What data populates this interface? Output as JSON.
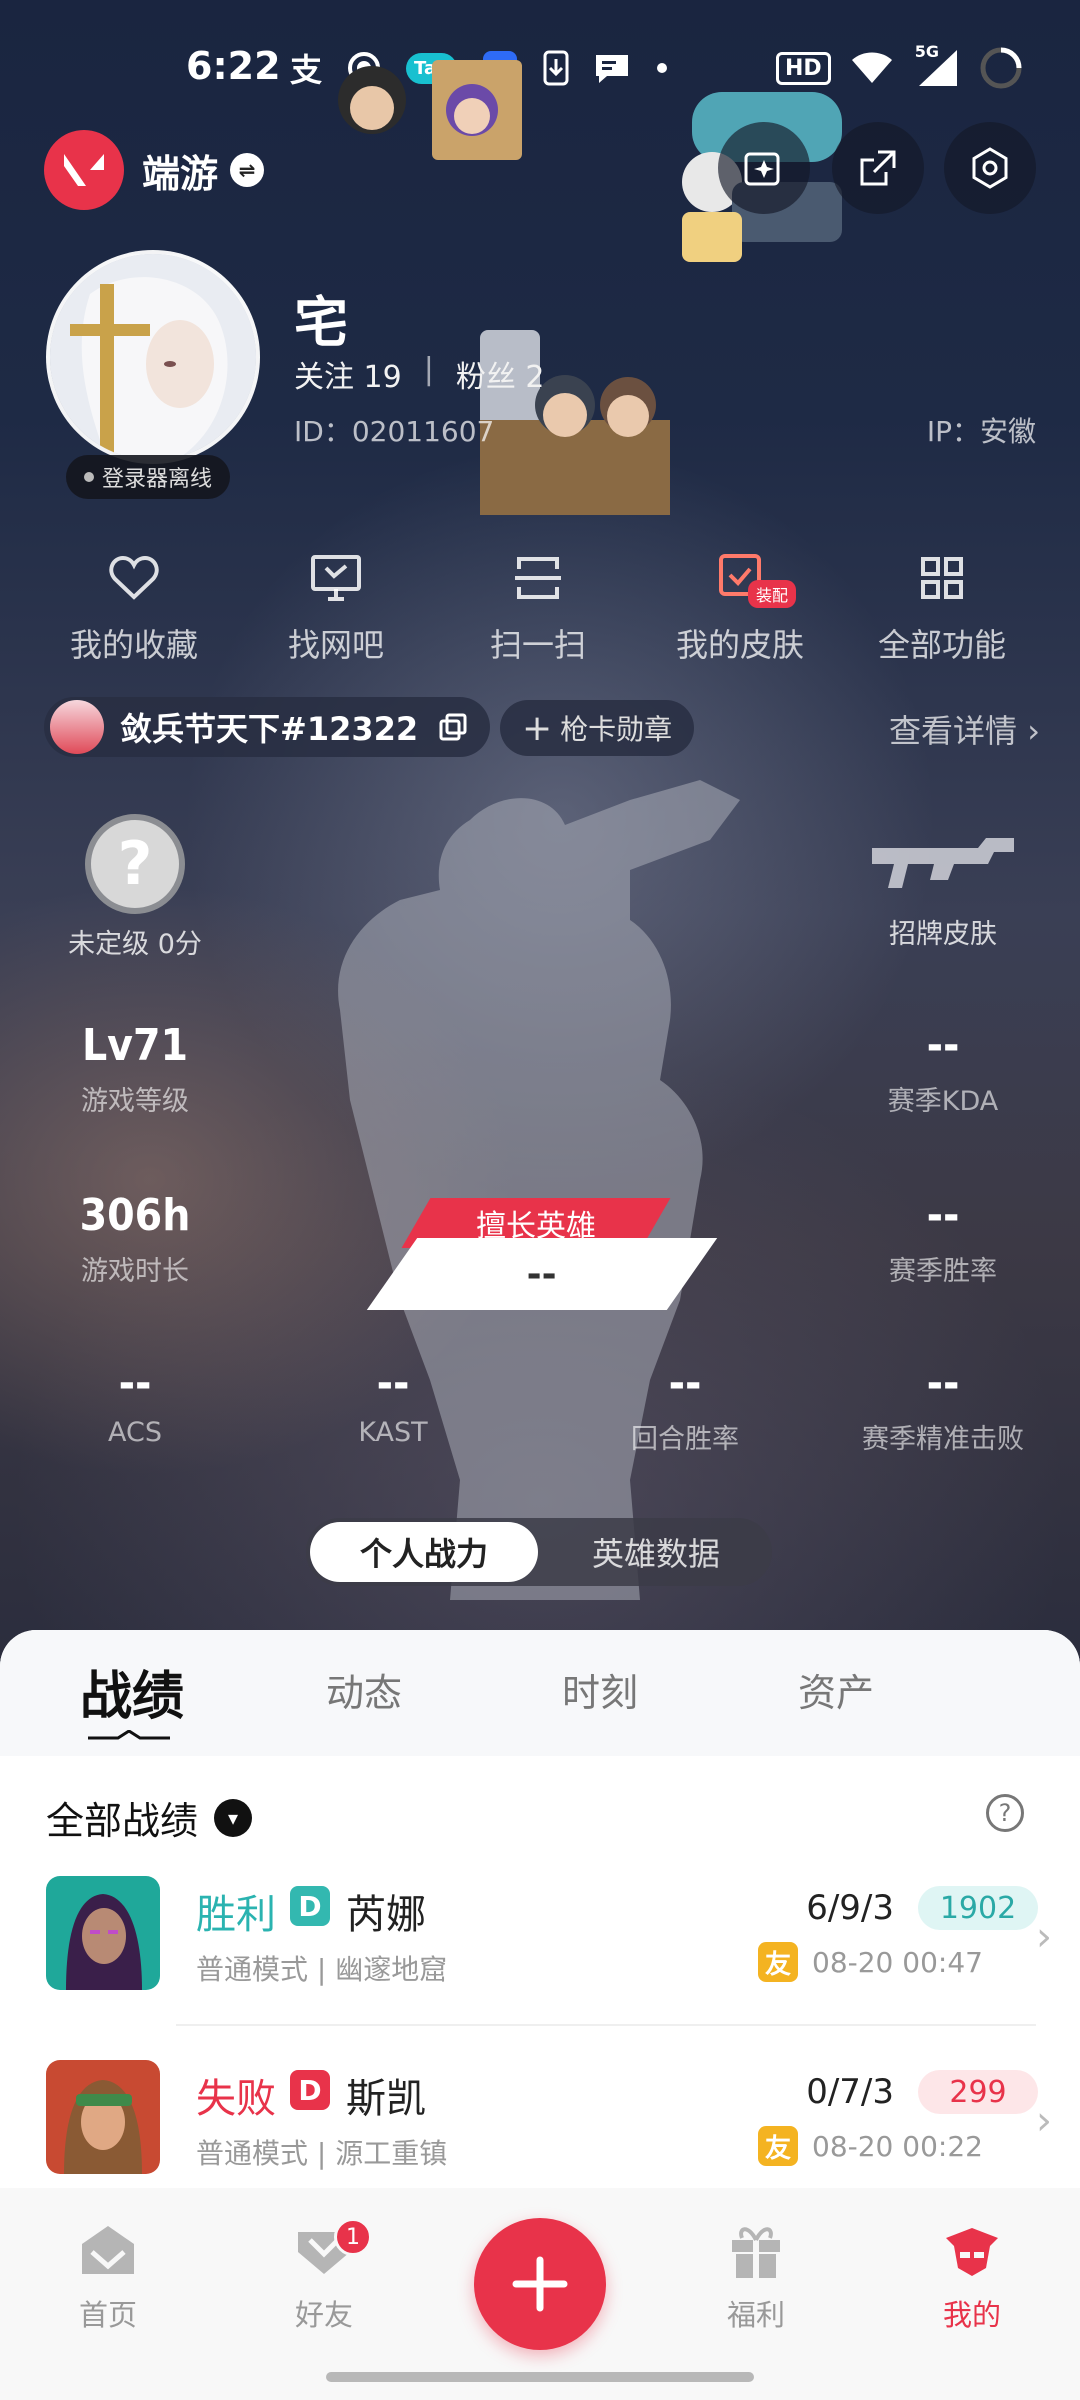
{
  "status_bar": {
    "time": "6:22",
    "icons": [
      "alipay-icon",
      "record-icon",
      "tap-icon",
      "baidu-icon",
      "download-icon",
      "message-icon",
      "dot-icon",
      "hd-icon",
      "wifi-icon",
      "signal-5g-icon",
      "battery-icon"
    ],
    "tap_label": "Tap",
    "hd_label": "HD",
    "net_label": "5G"
  },
  "header": {
    "app_name": "端游",
    "actions": [
      "ai-sparkle-icon",
      "share-icon",
      "settings-icon"
    ]
  },
  "profile": {
    "nickname": "宅",
    "follow_label": "关注 19",
    "separator": "|",
    "fans_label": "粉丝 2",
    "id_label": "ID：02011607",
    "ip_label": "IP：安徽",
    "status_tag": "登录器离线"
  },
  "quick_actions": [
    {
      "label": "我的收藏",
      "icon": "heart-icon"
    },
    {
      "label": "找网吧",
      "icon": "monitor-icon"
    },
    {
      "label": "扫一扫",
      "icon": "scan-icon"
    },
    {
      "label": "我的皮肤",
      "icon": "skin-icon",
      "badge": "装配"
    },
    {
      "label": "全部功能",
      "icon": "grid-icon"
    }
  ],
  "game_account": {
    "name": "敛兵节天下#12322",
    "medal_label": "枪卡勋章",
    "detail_label": "查看详情"
  },
  "stats": {
    "rank_label": "未定级 0分",
    "rank_icon_text": "?",
    "signature_skin_label": "招牌皮肤",
    "level_value": "Lv71",
    "level_label": "游戏等级",
    "kda_value": "--",
    "kda_label": "赛季KDA",
    "playtime_value": "306h",
    "playtime_label": "游戏时长",
    "winrate_value": "--",
    "winrate_label": "赛季胜率",
    "best_hero_tag": "擅长英雄",
    "best_hero_value": "--",
    "acs_value": "--",
    "acs_label": "ACS",
    "kast_value": "--",
    "kast_label": "KAST",
    "round_win_value": "--",
    "round_win_label": "回合胜率",
    "precision_value": "--",
    "precision_label": "赛季精准击败"
  },
  "mode_toggle": {
    "active": "个人战力",
    "inactive": "英雄数据"
  },
  "content_tabs": [
    "战绩",
    "动态",
    "时刻",
    "资产"
  ],
  "filter": {
    "label": "全部战绩",
    "help_icon": "?"
  },
  "matches": [
    {
      "result": "胜利",
      "result_color": "#2ab3b0",
      "rank_letter": "D",
      "rank_color": "#33b8b0",
      "agent": "芮娜",
      "mode": "普通模式 | 幽邃地窟",
      "kda": "6/9/3",
      "score": "1902",
      "score_color": "#2aa9a6",
      "score_bg": "#dff5f4",
      "friend_tag": "友",
      "time": "08-20 00:47"
    },
    {
      "result": "失败",
      "result_color": "#e8334a",
      "rank_letter": "D",
      "rank_color": "#e8334a",
      "agent": "斯凯",
      "mode": "普通模式 | 源工重镇",
      "kda": "0/7/3",
      "score": "299",
      "score_color": "#e8334a",
      "score_bg": "#fde6e8",
      "friend_tag": "友",
      "time": "08-20 00:22"
    }
  ],
  "bottom_nav": [
    {
      "label": "首页",
      "icon": "home-icon"
    },
    {
      "label": "好友",
      "icon": "friends-icon",
      "badge": "1"
    },
    {
      "label": "",
      "icon": "plus-icon"
    },
    {
      "label": "福利",
      "icon": "gift-icon"
    },
    {
      "label": "我的",
      "icon": "me-icon",
      "active": true
    }
  ],
  "colors": {
    "accent": "#e8334a",
    "win": "#2ab3b0",
    "loss": "#e8334a"
  }
}
